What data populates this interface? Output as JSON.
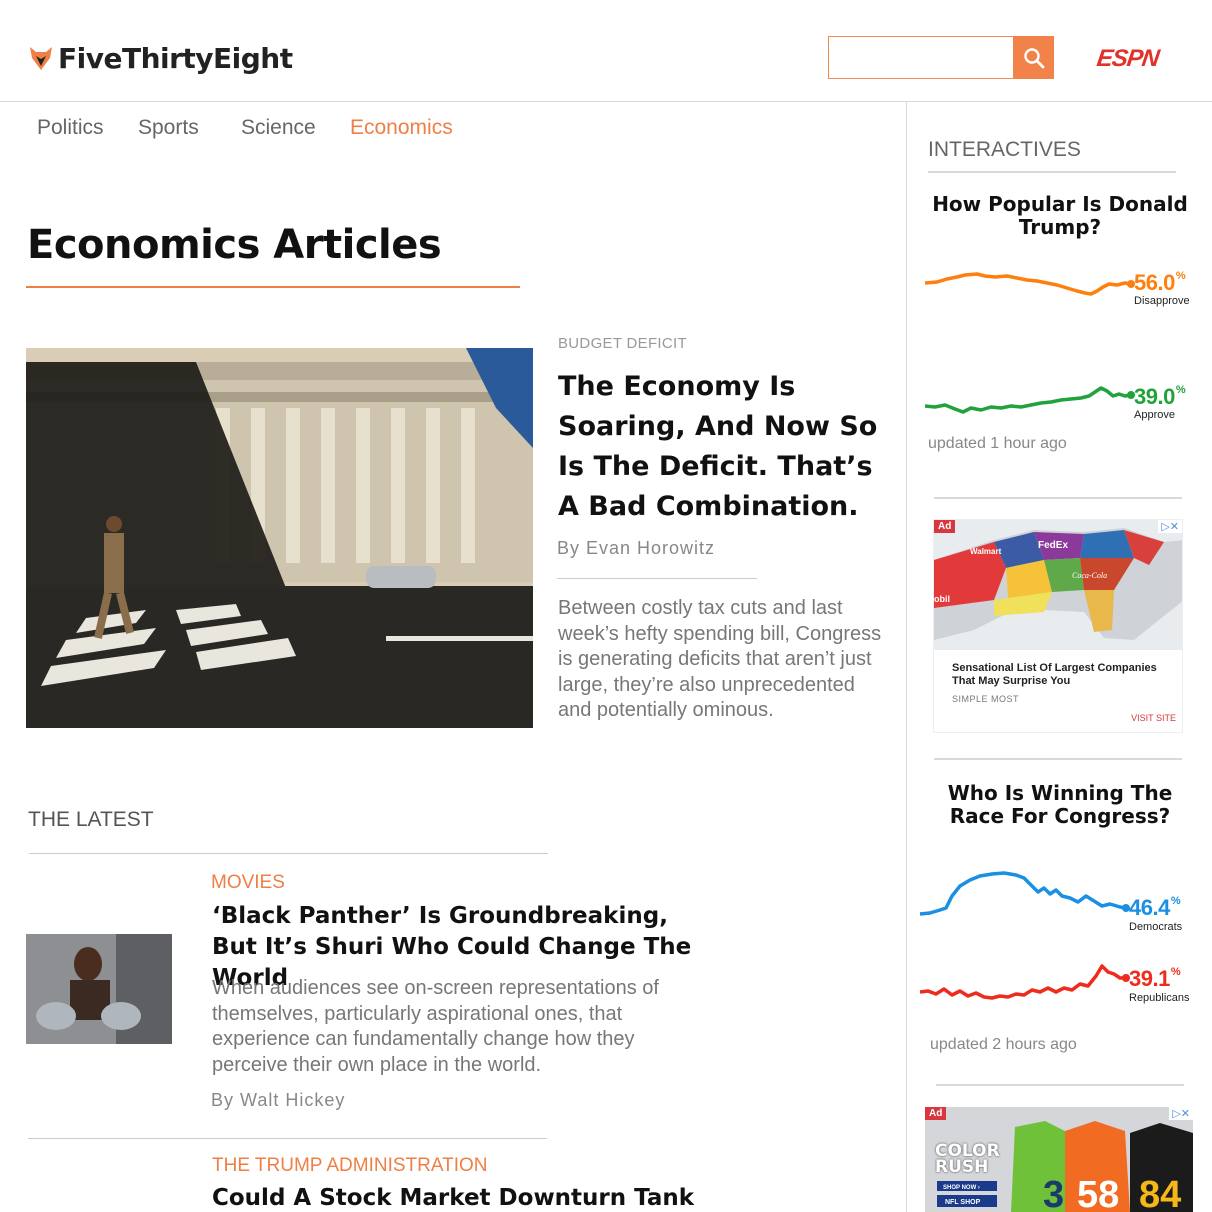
{
  "header": {
    "logo_text": "FiveThirtyEight",
    "search_placeholder": "",
    "espn_label": "ESPN"
  },
  "nav": {
    "items": [
      {
        "label": "Politics",
        "active": false
      },
      {
        "label": "Sports",
        "active": false
      },
      {
        "label": "Science",
        "active": false
      },
      {
        "label": "Economics",
        "active": true
      }
    ]
  },
  "page": {
    "title": "Economics Articles"
  },
  "featured": {
    "kicker": "Budget Deficit",
    "headline": "The Economy Is Soaring, And Now So Is The Deficit. That’s A Bad Combination.",
    "byline": "By Evan Horowitz",
    "dek": "Between costly tax cuts and last week’s hefty spending bill, Congress is generating deficits that aren’t just large, they’re also unprecedented and potentially ominous."
  },
  "latest": {
    "label": "The Latest",
    "articles": [
      {
        "kicker": "Movies",
        "headline": "‘Black Panther’ Is Groundbreaking, But It’s Shuri Who Could Change The World",
        "dek": "When audiences see on-screen representations of themselves, particularly aspirational ones, that experience can fundamentally change how they perceive their own place in the world.",
        "byline": "By Walt Hickey"
      },
      {
        "kicker": "The Trump Administration",
        "headline": "Could A Stock Market Downturn Tank"
      }
    ]
  },
  "sidebar": {
    "label": "Interactives",
    "trump": {
      "title": "How Popular Is Donald Trump?",
      "disapprove_value": "56.0",
      "disapprove_label": "Disapprove",
      "approve_value": "39.0",
      "approve_label": "Approve",
      "percent_sign": "%",
      "updated": "updated 1 hour ago",
      "colors": {
        "disapprove": "#ff7f0e",
        "approve": "#1fa33a"
      }
    },
    "ad1": {
      "badge": "Ad",
      "title": "Sensational List Of Largest Companies That May Surprise You",
      "brand": "Simple Most",
      "visit": "Visit Site",
      "map_labels": [
        "Walmart",
        "FedEx",
        "Coca-Cola",
        "obil"
      ]
    },
    "congress": {
      "title": "Who Is Winning The Race For Congress?",
      "dem_value": "46.4",
      "dem_label": "Democrats",
      "rep_value": "39.1",
      "rep_label": "Republicans",
      "percent_sign": "%",
      "updated": "updated 2 hours ago",
      "colors": {
        "dem": "#1a8fe3",
        "rep": "#ee2b1c"
      }
    },
    "ad2": {
      "badge": "Ad",
      "text_line1": "COLOR",
      "text_line2": "RUSH",
      "shop_now": "SHOP NOW ›",
      "shop_label": "NFL SHOP",
      "jersey_numbers": [
        "3",
        "58",
        "84"
      ]
    }
  },
  "colors": {
    "accent": "#ef7f45",
    "espn_red": "#e0322b"
  }
}
